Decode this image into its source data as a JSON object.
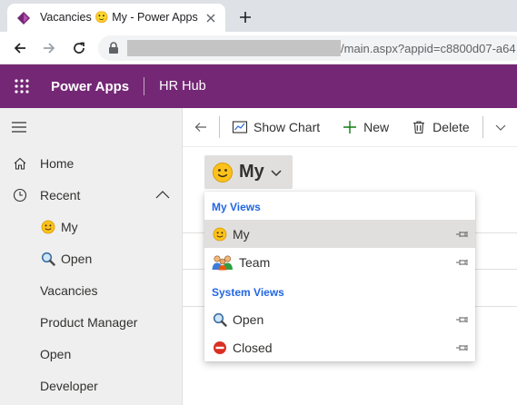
{
  "browser": {
    "tab_title": "Vacancies 🙂 My - Power Apps",
    "url_suffix": "/main.aspx?appid=c8800d07-a64"
  },
  "app": {
    "brand": "Power Apps",
    "name": "HR Hub",
    "header_color": "#742774"
  },
  "sidebar": {
    "home": "Home",
    "recent": "Recent",
    "recent_items": [
      {
        "label": "My",
        "icon": "smiley-icon"
      },
      {
        "label": "Open",
        "icon": "magnifier-icon"
      },
      {
        "label": "Vacancies"
      },
      {
        "label": "Product Manager"
      },
      {
        "label": "Open"
      },
      {
        "label": "Developer"
      }
    ]
  },
  "commandbar": {
    "show_chart": "Show Chart",
    "new": "New",
    "delete": "Delete"
  },
  "view_selector": {
    "current": "My",
    "icon": "smiley-icon"
  },
  "dropdown": {
    "my_views_header": "My Views",
    "system_views_header": "System Views",
    "my_views": [
      {
        "label": "My",
        "icon": "smiley-icon",
        "selected": true
      },
      {
        "label": "Team",
        "icon": "team-icon",
        "selected": false
      }
    ],
    "system_views": [
      {
        "label": "Open",
        "icon": "magnifier-icon"
      },
      {
        "label": "Closed",
        "icon": "no-entry-icon"
      }
    ],
    "accent_color": "#2266e3"
  }
}
